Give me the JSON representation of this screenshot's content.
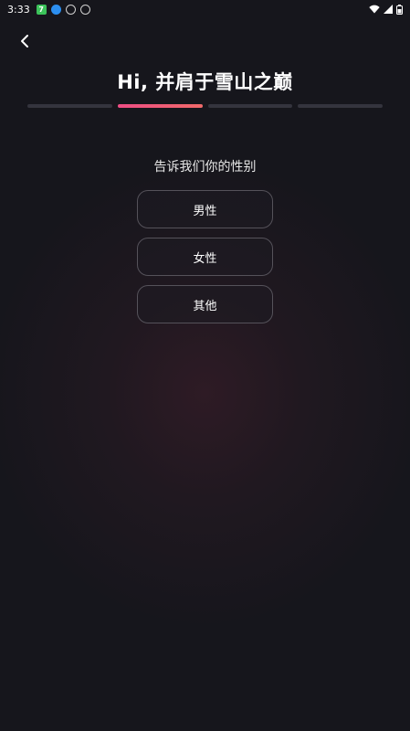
{
  "status_bar": {
    "time": "3:33",
    "notif_badge": "7"
  },
  "icons": {
    "back": "chevron-left-icon",
    "wifi": "wifi-icon",
    "signal": "signal-icon",
    "battery": "battery-icon"
  },
  "header": {
    "title": "Hi, 并肩于雪山之巅"
  },
  "progress": {
    "total_steps": 4,
    "current_step": 2,
    "active_color": "#ee4d84"
  },
  "gender": {
    "question": "告诉我们你的性别",
    "options": [
      "男性",
      "女性",
      "其他"
    ]
  }
}
